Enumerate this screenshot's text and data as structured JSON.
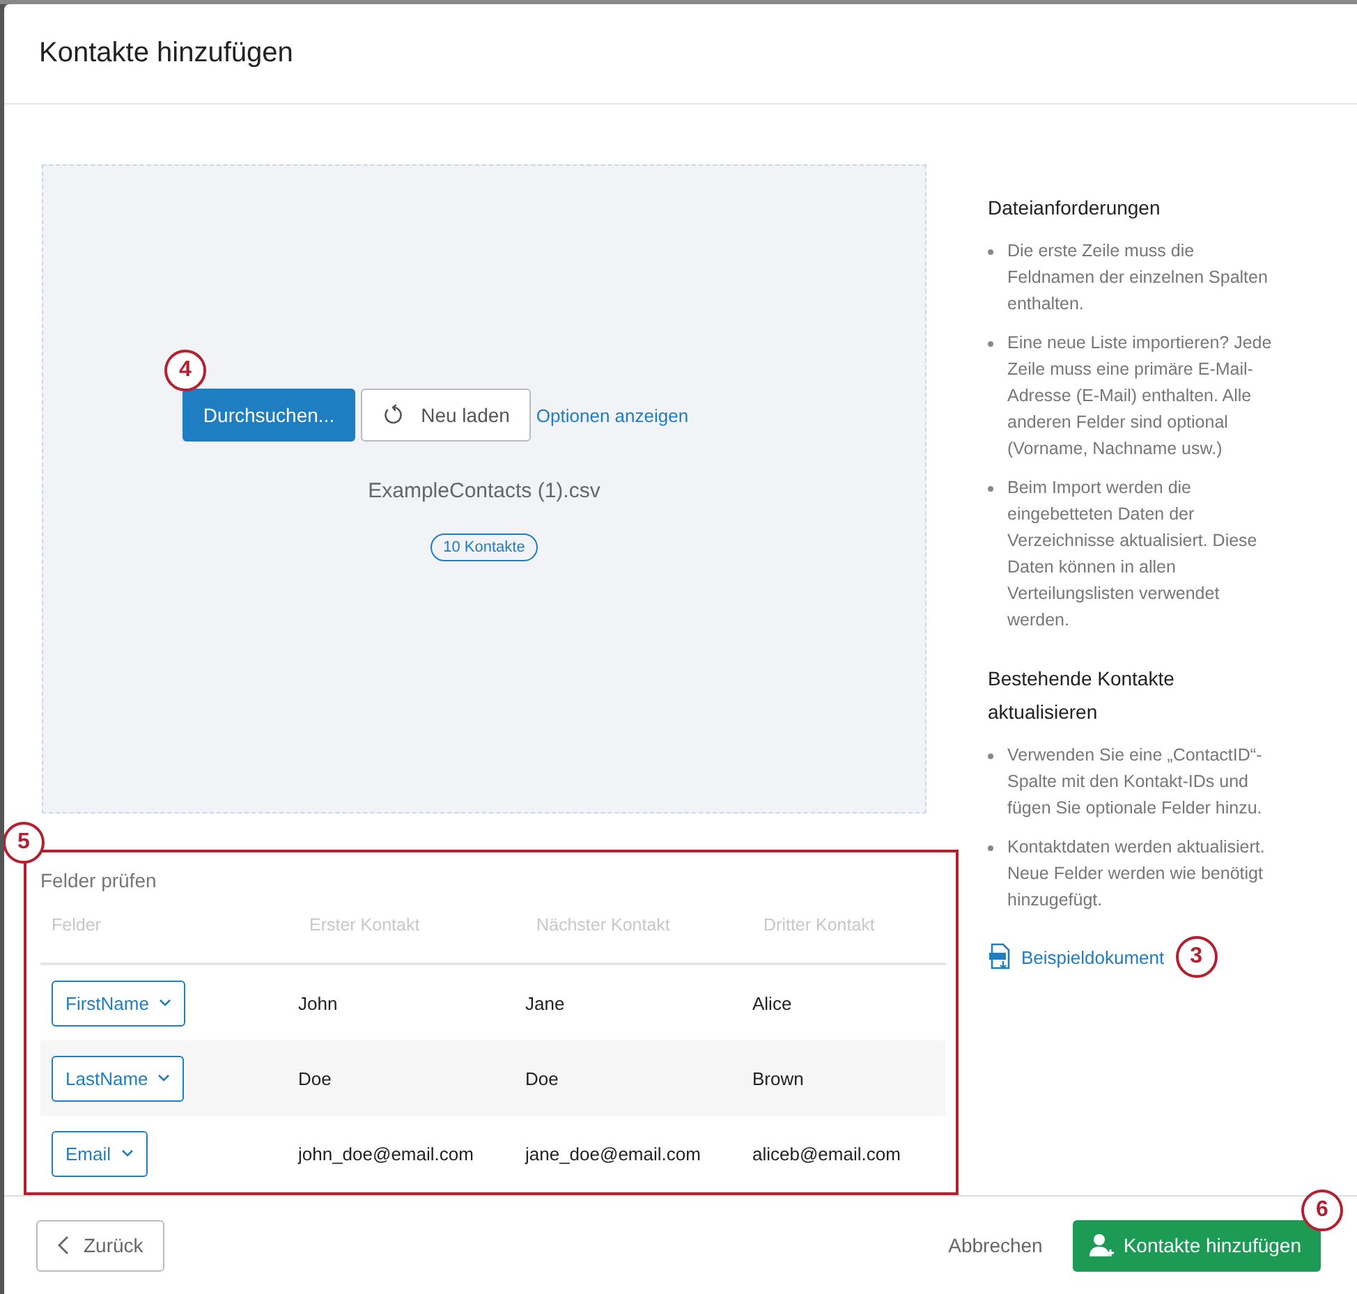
{
  "dialog": {
    "title": "Kontakte hinzufügen"
  },
  "upload": {
    "callout": "4",
    "browse_button": "Durchsuchen...",
    "reload_button": "Neu laden",
    "options_link": "Optionen anzeigen",
    "file_name": "ExampleContacts (1).csv",
    "count_badge": "10 Kontakte"
  },
  "review": {
    "callout": "5",
    "highlighted": true,
    "title": "Felder prüfen",
    "columns": [
      "Felder",
      "Erster Kontakt",
      "Nächster Kontakt",
      "Dritter Kontakt"
    ],
    "rows": [
      {
        "field": "FirstName",
        "values": [
          "John",
          "Jane",
          "Alice"
        ]
      },
      {
        "field": "LastName",
        "values": [
          "Doe",
          "Doe",
          "Brown"
        ]
      },
      {
        "field": "Email",
        "values": [
          "john_doe@email.com",
          "jane_doe@email.com",
          "aliceb@email.com"
        ]
      }
    ]
  },
  "sidebar": {
    "sections": [
      {
        "heading": "Dateianforderungen",
        "items": [
          "Die erste Zeile muss die Feldnamen der einzelnen Spalten enthalten.",
          "Eine neue Liste importieren? Jede Zeile muss eine primäre E-Mail-Adresse (E-Mail) enthalten. Alle anderen Felder sind optional (Vorname, Nachname usw.)",
          "Beim Import werden die eingebetteten Daten der Verzeichnisse aktualisiert. Diese Daten können in allen Verteilungslisten verwendet werden."
        ]
      },
      {
        "heading": "Bestehende Kontakte aktualisieren",
        "items": [
          "Verwenden Sie eine „ContactID“-Spalte mit den Kontakt-IDs und fügen Sie optionale Felder hinzu.",
          "Kontaktdaten werden aktualisiert. Neue Felder werden wie benötigt hinzugefügt."
        ]
      }
    ],
    "sample_link": "Beispieldokument",
    "sample_callout": "3"
  },
  "footer": {
    "back_button": "Zurück",
    "cancel_button": "Abbrechen",
    "submit_button": "Kontakte hinzufügen",
    "submit_callout": "6"
  }
}
